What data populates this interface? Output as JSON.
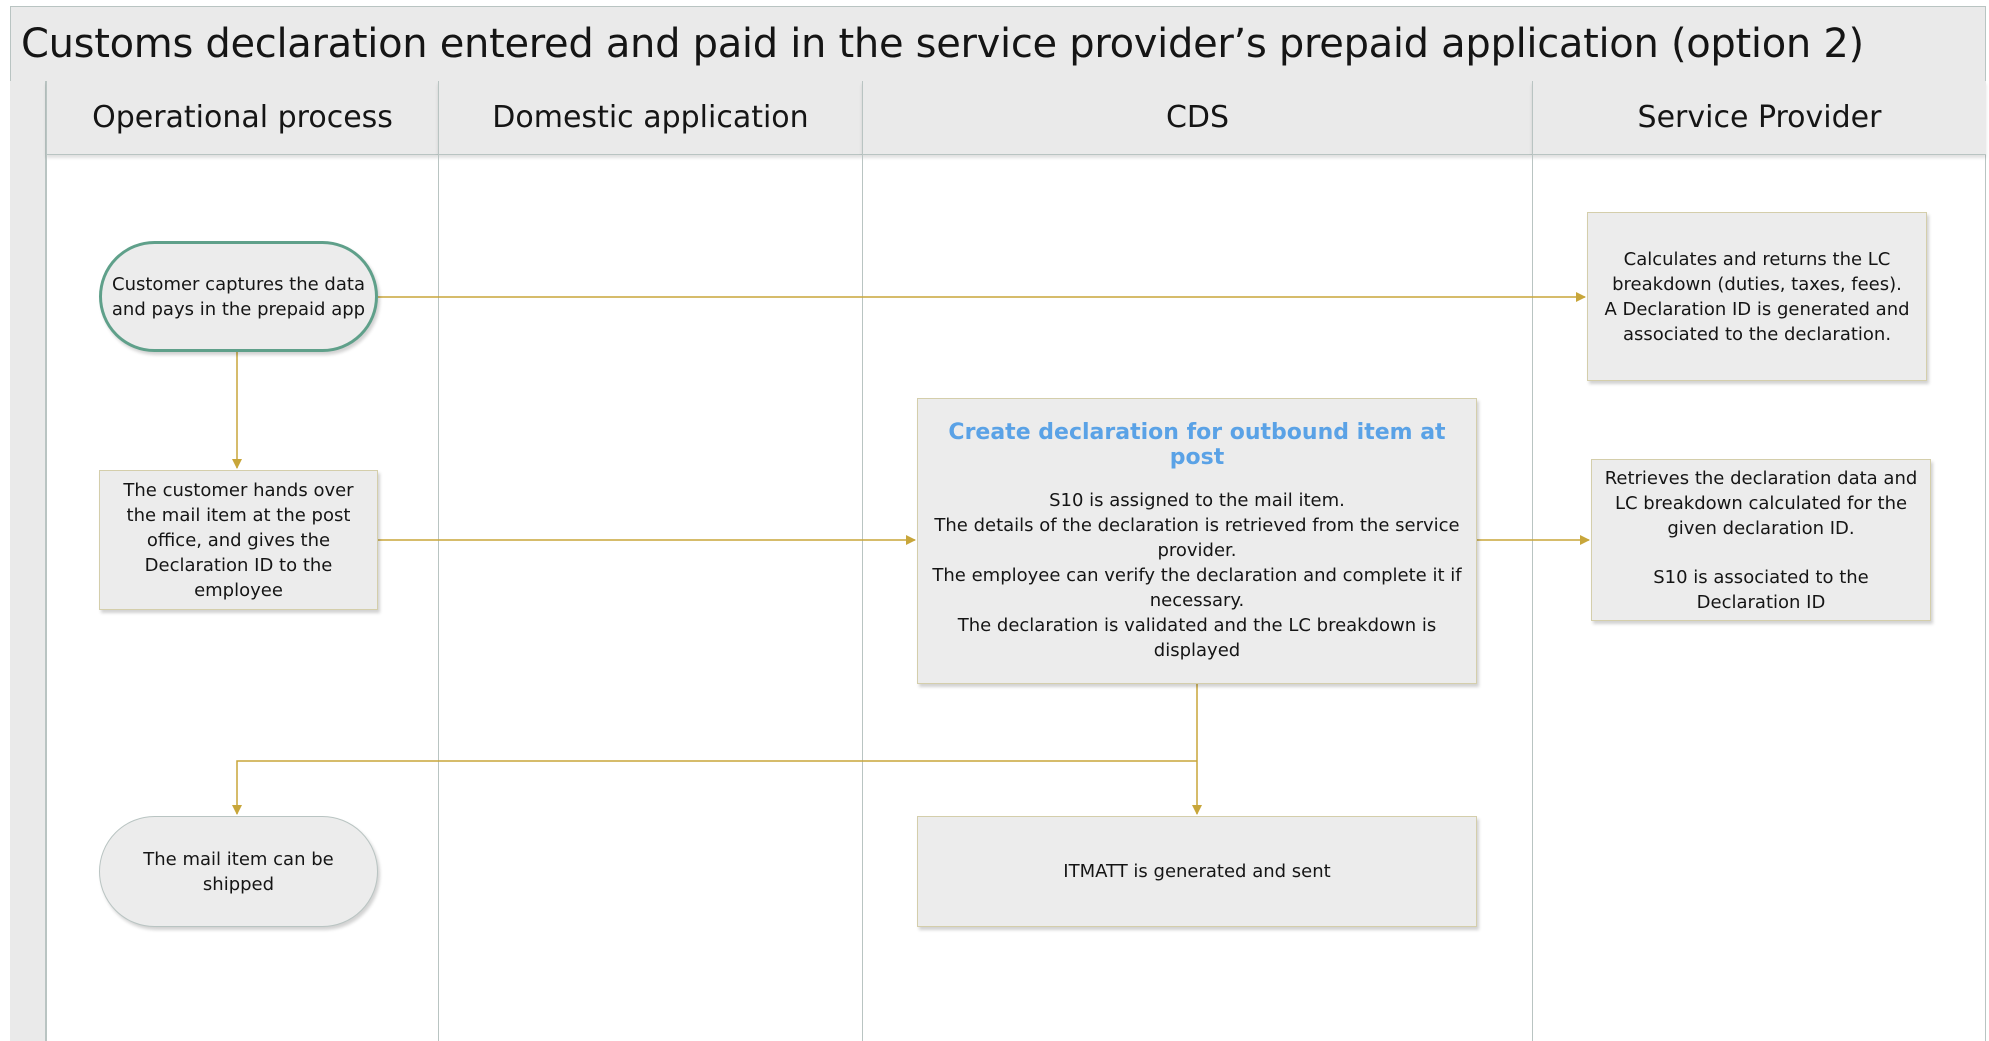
{
  "title": "Customs declaration entered and paid in the service provider’s prepaid application (option 2)",
  "lanes": [
    {
      "label": "Operational process"
    },
    {
      "label": "Domestic application"
    },
    {
      "label": "CDS"
    },
    {
      "label": "Service Provider"
    }
  ],
  "nodes": {
    "customer_captures": {
      "text": "Customer captures the data and pays in the prepaid app"
    },
    "customer_hands_over": {
      "text": "The customer hands over the mail item at the post office, and gives the Declaration ID to the employee"
    },
    "mail_shipped": {
      "text": "The mail item can be shipped"
    },
    "create_declaration": {
      "title": "Create declaration for outbound item at post",
      "lines": [
        "S10 is assigned to the mail item.",
        "The details of the declaration is retrieved from the service provider.",
        "The employee can verify the declaration and complete it if necessary.",
        "The declaration is validated and the LC breakdown is displayed"
      ]
    },
    "itmatt_generated": {
      "text": "ITMATT is generated and sent"
    },
    "calculates_lc": {
      "lines": [
        "Calculates and returns the LC breakdown (duties, taxes, fees).",
        "A Declaration ID is generated and associated to the declaration."
      ]
    },
    "retrieves_data": {
      "line1": "Retrieves the declaration data and LC breakdown calculated for the given declaration ID.",
      "line2": "S10 is associated to the Declaration ID"
    }
  },
  "colors": {
    "connector": "#c8a63a",
    "lane_border": "#b9c4c2",
    "box_fill": "#ececec",
    "box_border": "#d4ceab",
    "start_border": "#5fa08a",
    "title_accent": "#5aa2e6"
  }
}
